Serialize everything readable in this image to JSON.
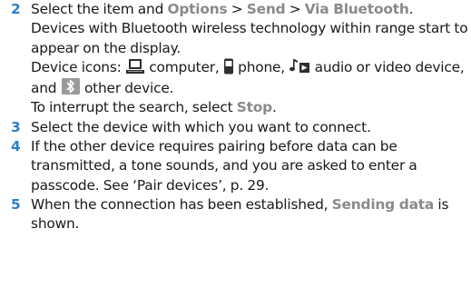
{
  "steps": [
    {
      "number": "2",
      "intro_before": "Select the item and ",
      "options": "Options",
      "sep1": " > ",
      "send": "Send",
      "sep2": " > ",
      "via_bluetooth": "Via Bluetooth",
      "intro_end": ".",
      "devices_text": "Devices with Bluetooth wireless technology within range start to appear on the display.",
      "icons_prefix": "Device icons: ",
      "icon_computer": "computer-icon",
      "computer_label": " computer, ",
      "icon_phone": "phone-icon",
      "phone_label": " phone, ",
      "icon_audio": "audio-video-icon",
      "audio_label": " audio or video device, and ",
      "icon_other": "bluetooth-icon",
      "other_label": " other device.",
      "interrupt_before": "To interrupt the search, select ",
      "stop": "Stop",
      "interrupt_end": "."
    },
    {
      "number": "3",
      "text": "Select the device with which you want to connect."
    },
    {
      "number": "4",
      "text": "If the other device requires pairing before data can be transmitted, a tone sounds, and you are asked to enter a passcode. See ‘Pair devices’, p. 29."
    },
    {
      "number": "5",
      "before": "When the connection has been established, ",
      "sending_data": "Sending data",
      "after": " is shown."
    }
  ],
  "colors": {
    "step_number": "#2f7fc4",
    "ui_term": "#8a8a8a",
    "text": "#1a1a1a"
  }
}
